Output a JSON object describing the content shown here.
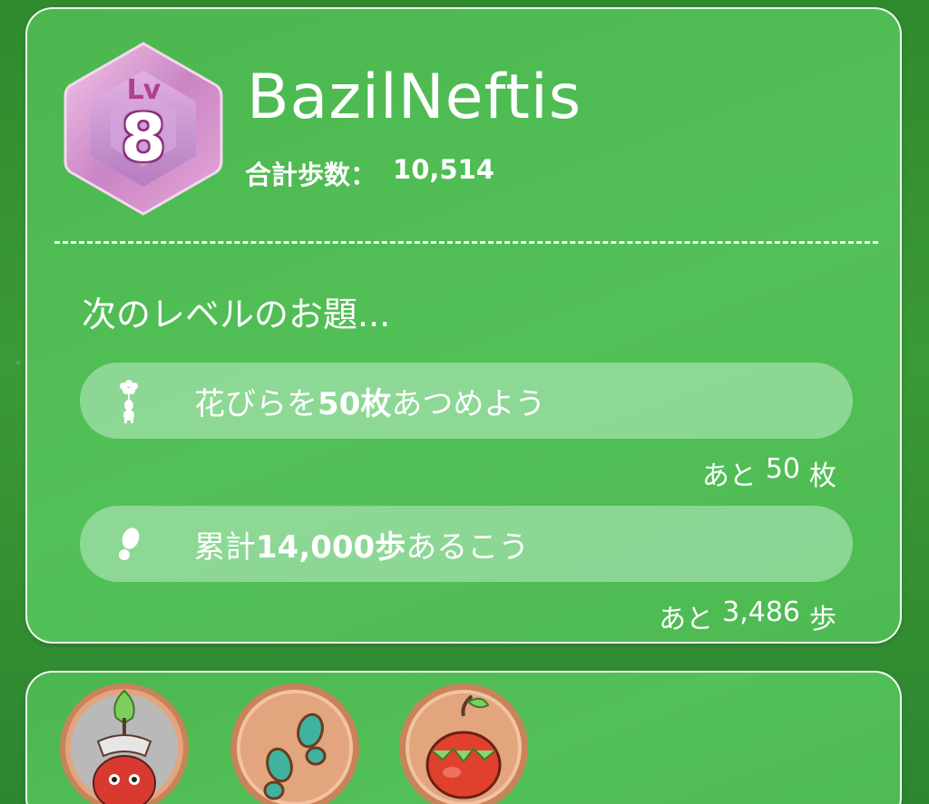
{
  "profile": {
    "level_prefix": "Lv",
    "level": "8",
    "username": "BazilNeftis",
    "total_steps_label": "合計歩数：",
    "total_steps_value": "10,514"
  },
  "next_level": {
    "title": "次のレベルのお題...",
    "tasks": [
      {
        "icon": "petal-pikmin-icon",
        "text_pre": "花びらを",
        "text_bold": "50枚",
        "text_post": "あつめよう",
        "remain_prefix": "あと",
        "remain_value": "50",
        "remain_unit": "枚"
      },
      {
        "icon": "footprint-icon",
        "text_pre": "累計",
        "text_bold": "14,000歩",
        "text_post": "あるこう",
        "remain_prefix": "あと",
        "remain_value": "3,486",
        "remain_unit": "歩"
      }
    ]
  },
  "badges": [
    {
      "icon": "red-pikmin-medal-icon"
    },
    {
      "icon": "footsteps-medal-icon"
    },
    {
      "icon": "fruit-medal-icon"
    }
  ],
  "colors": {
    "card_green": "#4fbc53",
    "badge_pink": "#d98ac8",
    "pill": "#bfe9c8"
  }
}
